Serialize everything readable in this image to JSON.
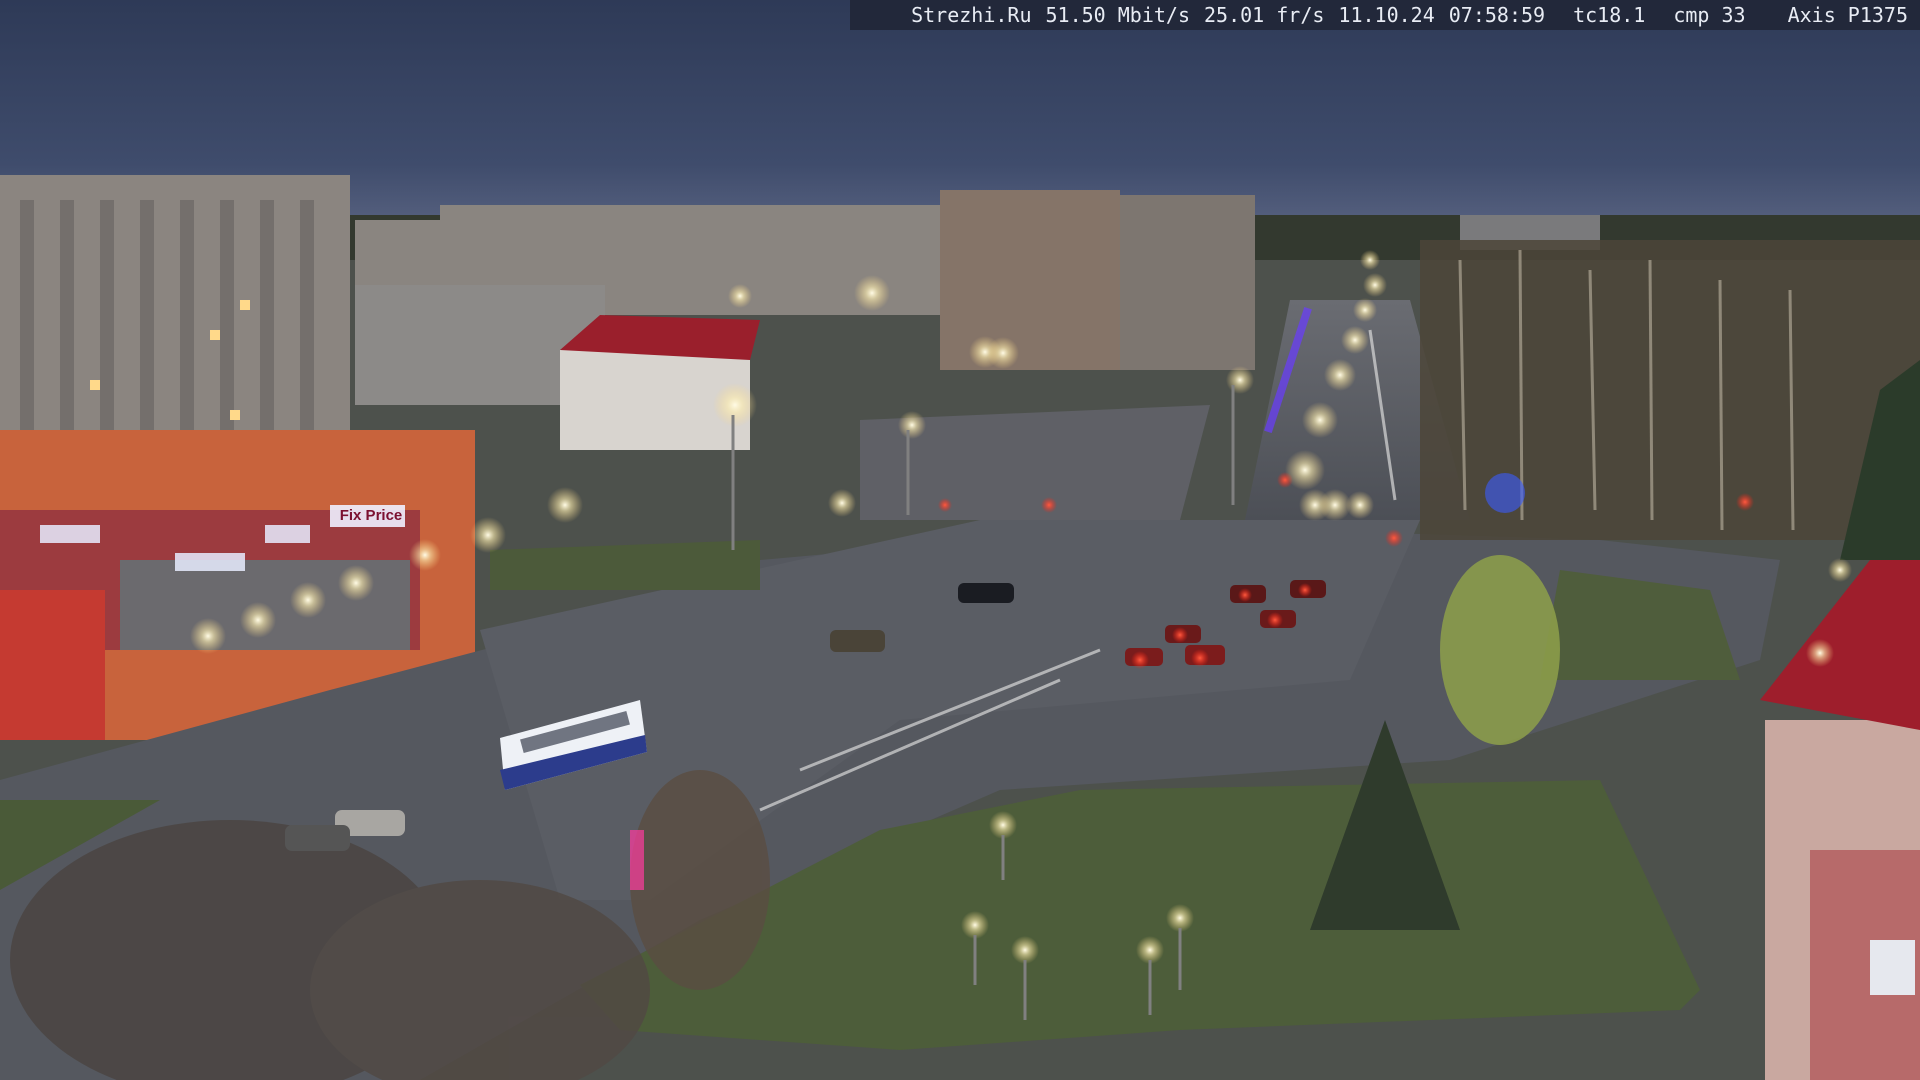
{
  "overlay": {
    "site": "Strezhi.Ru",
    "bitrate": "51.50 Mbit/s",
    "framerate": "25.01 fr/s",
    "date": "11.10.24",
    "time": "07:58:59",
    "tc": "tc18.1",
    "cmp": "cmp 33",
    "camera_model": "Axis P1375"
  },
  "storefront_signs": [
    "Fix Price"
  ],
  "colors": {
    "sky_top": "#2f3b58",
    "sky_horizon": "#4c5878",
    "road": "#52565e",
    "grass": "#4a5a3a",
    "streetlight": "#fff6d8",
    "taillight": "#ff3a2a",
    "bus": "#e8ecf4",
    "red_roof": "#9a1f2c"
  }
}
